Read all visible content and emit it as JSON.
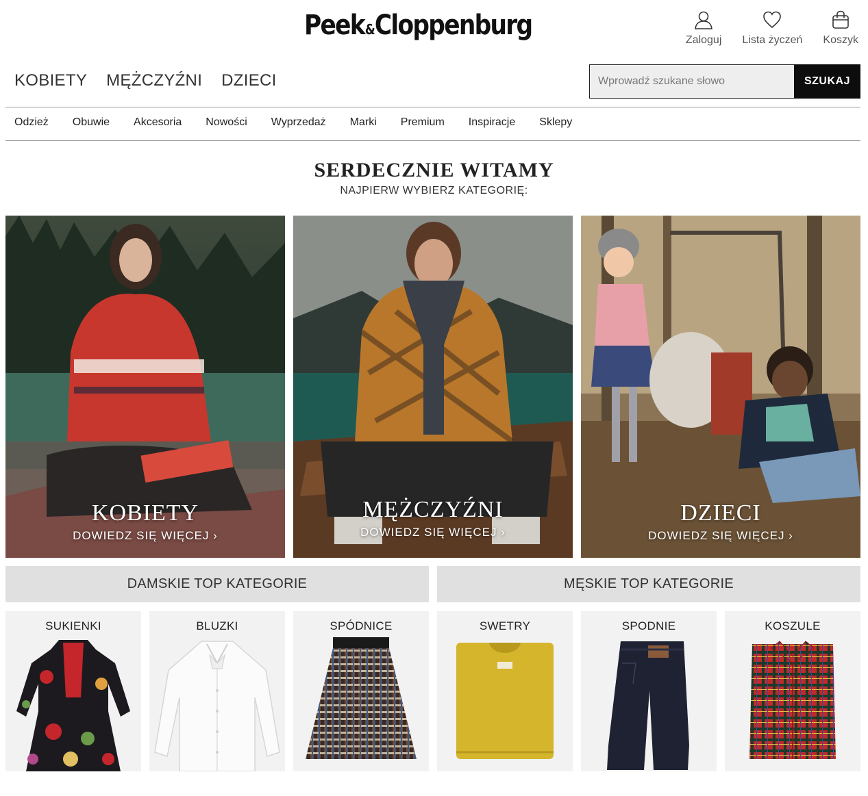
{
  "header": {
    "logo_left": "Peek",
    "logo_amp": "&",
    "logo_right": "Cloppenburg",
    "actions": [
      {
        "label": "Zaloguj",
        "icon": "user-icon"
      },
      {
        "label": "Lista życzeń",
        "icon": "heart-icon"
      },
      {
        "label": "Koszyk",
        "icon": "bag-icon"
      }
    ]
  },
  "gender_nav": [
    "KOBIETY",
    "MĘŻCZYŹNI",
    "DZIECI"
  ],
  "search": {
    "placeholder": "Wprowadź szukane słowo",
    "button": "SZUKAJ"
  },
  "category_nav": [
    "Odzież",
    "Obuwie",
    "Akcesoria",
    "Nowości",
    "Wyprzedaż",
    "Marki",
    "Premium",
    "Inspiracje",
    "Sklepy"
  ],
  "welcome": {
    "title": "SERDECZNIE WITAMY",
    "subtitle": "NAJPIERW WYBIERZ KATEGORIĘ:"
  },
  "heroes": [
    {
      "title": "KOBIETY",
      "more": "DOWIEDZ SIĘ WIĘCEJ ›"
    },
    {
      "title": "MĘŻCZYŹNI",
      "more": "DOWIEDZ SIĘ WIĘCEJ ›"
    },
    {
      "title": "DZIECI",
      "more": "DOWIEDZ SIĘ WIĘCEJ ›"
    }
  ],
  "top_categories": {
    "women_heading": "DAMSKIE TOP KATEGORIE",
    "men_heading": "MĘSKIE TOP KATEGORIE",
    "women": [
      {
        "label": "SUKIENKI",
        "icon": "dress-icon"
      },
      {
        "label": "BLUZKI",
        "icon": "blouse-icon"
      },
      {
        "label": "SPÓDNICE",
        "icon": "skirt-icon"
      }
    ],
    "men": [
      {
        "label": "SWETRY",
        "icon": "sweater-icon"
      },
      {
        "label": "SPODNIE",
        "icon": "jeans-icon"
      },
      {
        "label": "KOSZULE",
        "icon": "shirt-icon"
      }
    ]
  },
  "colors": {
    "accent": "#0d0d0d",
    "tile_bg": "#f2f2f2",
    "heading_bg": "#e0e0e0"
  }
}
